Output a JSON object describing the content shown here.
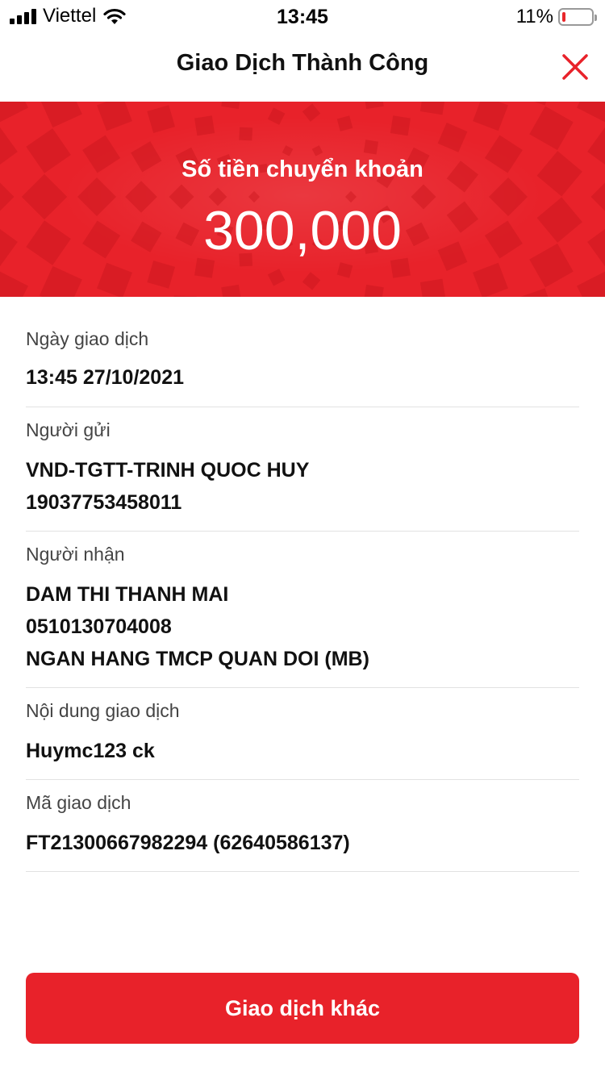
{
  "status_bar": {
    "carrier": "Viettel",
    "time": "13:45",
    "battery_percent": "11%",
    "battery_level": 0.11,
    "battery_color": "#e8272b"
  },
  "header": {
    "title": "Giao Dịch Thành Công",
    "close_icon": "close-icon",
    "accent_color": "#e8222a"
  },
  "banner": {
    "label": "Số tiền chuyển khoản",
    "amount": "300,000",
    "background": "#e8222a"
  },
  "details": {
    "date": {
      "label": "Ngày giao dịch",
      "value": "13:45 27/10/2021"
    },
    "sender": {
      "label": "Người gửi",
      "name": "VND-TGTT-TRINH QUOC HUY",
      "account": "19037753458011"
    },
    "recipient": {
      "label": "Người nhận",
      "name": "DAM THI THANH MAI",
      "account": "0510130704008",
      "bank": "NGAN HANG TMCP QUAN DOI (MB)"
    },
    "content": {
      "label": "Nội dung giao dịch",
      "value": "Huymc123 ck"
    },
    "code": {
      "label": "Mã giao dịch",
      "value": "FT21300667982294 (62640586137)"
    }
  },
  "footer": {
    "button_label": "Giao dịch khác"
  }
}
